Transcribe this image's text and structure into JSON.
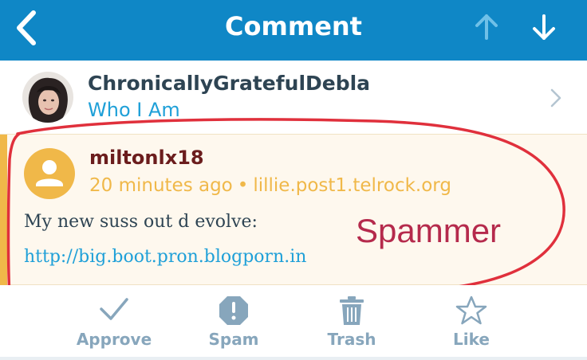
{
  "colors": {
    "nav_bg": "#0f87c6",
    "accent": "#f0b849",
    "link": "#1fa0d8",
    "text_dark": "#2e4453",
    "annotation": "#b52a4c",
    "action_gray": "#87a6bc"
  },
  "nav": {
    "title": "Comment",
    "back_icon": "chevron-left-icon",
    "prev_icon": "arrow-up-icon",
    "next_icon": "arrow-down-icon"
  },
  "post": {
    "author": "ChronicallyGratefulDebla",
    "title": "Who I Am"
  },
  "comment": {
    "author": "miltonlx18",
    "time": "20 minutes ago",
    "site": "lillie.post1.telrock.org",
    "text": "My new suss out d evolve:",
    "link": "http://big.boot.pron.blogporn.in"
  },
  "annotation": {
    "label": "Spammer"
  },
  "actions": [
    {
      "label": "Approve",
      "icon": "checkmark-icon"
    },
    {
      "label": "Spam",
      "icon": "spam-icon"
    },
    {
      "label": "Trash",
      "icon": "trash-icon"
    },
    {
      "label": "Like",
      "icon": "star-icon"
    }
  ]
}
